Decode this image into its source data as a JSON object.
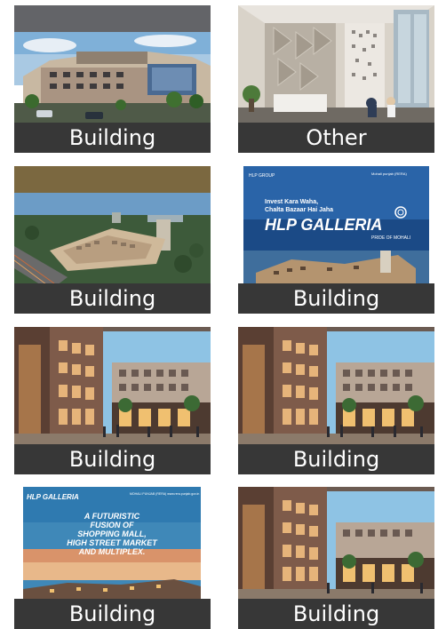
{
  "gallery": {
    "items": [
      {
        "label": "Building",
        "image": "building-exterior-photo"
      },
      {
        "label": "Other",
        "image": "lobby-interior-photo"
      },
      {
        "label": "Building",
        "image": "aerial-project-render"
      },
      {
        "label": "Building",
        "image": "hlp-galleria-brochure"
      },
      {
        "label": "Building",
        "image": "high-street-render"
      },
      {
        "label": "Building",
        "image": "high-street-render"
      },
      {
        "label": "Building",
        "image": "hlp-galleria-poster"
      },
      {
        "label": "Building",
        "image": "high-street-render"
      }
    ]
  },
  "brochure": {
    "brand_small": "HLP GROUP",
    "tagline_1": "Invest Kara Waha,",
    "tagline_2": "Chalta Bazaar Hai Jaha",
    "brand": "HLP GALLERIA",
    "sub": "PRIDE OF MOHALI",
    "rera": "Mohali punjab (RERA)"
  },
  "poster": {
    "brand": "HLP GALLERIA",
    "rera": "MOHALI PUNJAB (RERA) www.rera.punjab.gov.in",
    "line1": "A FUTURISTIC",
    "line2": "FUSION OF",
    "line3": "SHOPPING MALL,",
    "line4": "HIGH STREET MARKET",
    "line5": "AND MULTIPLEX."
  }
}
